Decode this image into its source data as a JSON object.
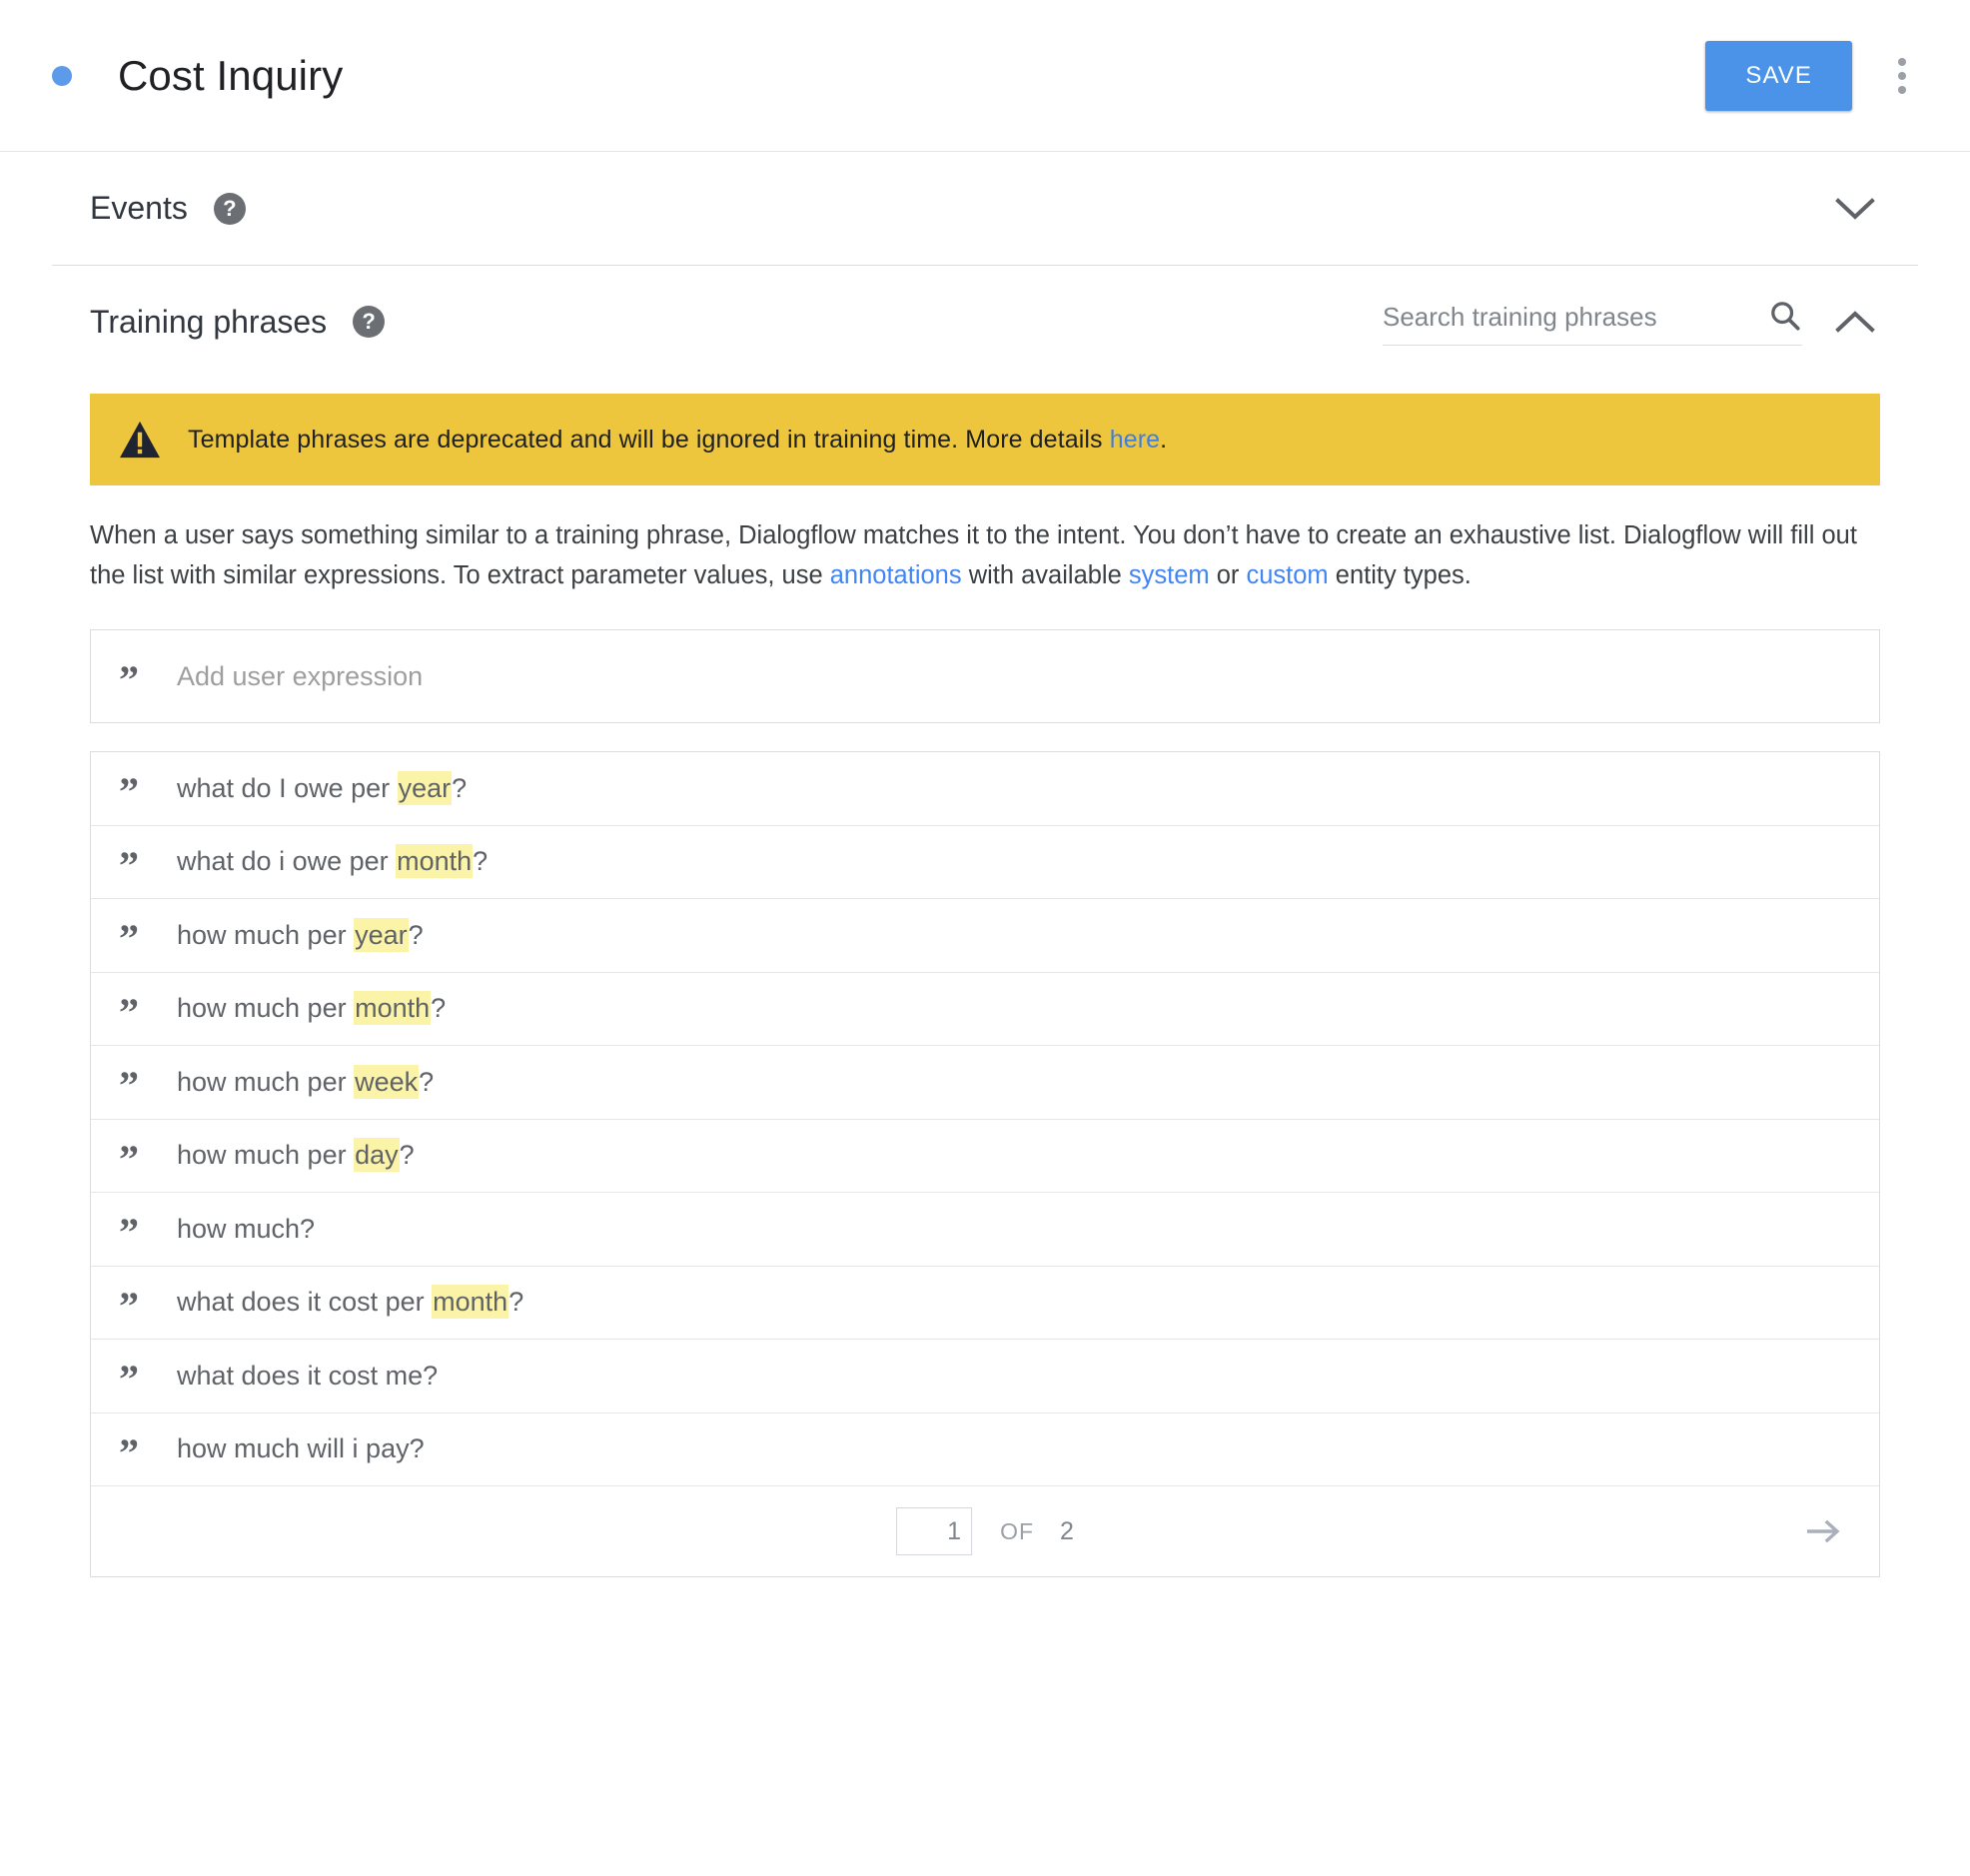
{
  "topbar": {
    "status_dot": "status-dot",
    "title": "Cost Inquiry",
    "save_label": "SAVE",
    "overflow_icon": "more-vert-icon"
  },
  "events": {
    "title": "Events",
    "help_glyph": "?",
    "expand_icon": "chevron-down-icon"
  },
  "training": {
    "title": "Training phrases",
    "help_glyph": "?",
    "search_placeholder": "Search training phrases",
    "search_value": "",
    "search_icon": "search-icon",
    "collapse_icon": "chevron-up-icon",
    "warning": {
      "icon": "warning-triangle-icon",
      "text_before": "Template phrases are deprecated and will be ignored in training time. More details ",
      "link_label": "here",
      "text_after": ".",
      "background": "#edc63e",
      "link_color": "#3f7fe0"
    },
    "description": {
      "part1": "When a user says something similar to a training phrase, Dialogflow matches it to the intent. You don’t have to create an exhaustive list. Dialogflow will fill out the list with similar expressions. To extract parameter values, use ",
      "link1": "annotations",
      "part2": " with available ",
      "link2": "system",
      "part3": " or ",
      "link3": "custom",
      "part4": " entity types.",
      "link_color": "#4285f4"
    },
    "add_expression_placeholder": "Add user expression",
    "add_expression_value": "",
    "quote_glyph": "”",
    "highlight_color": "#fbf4a8",
    "phrases": [
      {
        "before": "what do I owe per ",
        "highlight": "year",
        "after": "?"
      },
      {
        "before": "what do i owe per ",
        "highlight": "month",
        "after": "?"
      },
      {
        "before": "how much per ",
        "highlight": "year",
        "after": "?"
      },
      {
        "before": "how much per ",
        "highlight": "month",
        "after": "?"
      },
      {
        "before": "how much per ",
        "highlight": "week",
        "after": "?"
      },
      {
        "before": "how much per ",
        "highlight": "day",
        "after": "?"
      },
      {
        "before": "how much?",
        "highlight": "",
        "after": ""
      },
      {
        "before": "what does it cost per ",
        "highlight": "month",
        "after": "?"
      },
      {
        "before": "what does it cost me?",
        "highlight": "",
        "after": ""
      },
      {
        "before": "how much will i pay?",
        "highlight": "",
        "after": ""
      }
    ],
    "pagination": {
      "current_page": "1",
      "of_label": "OF",
      "total_pages": "2",
      "next_icon": "arrow-right-icon"
    }
  },
  "colors": {
    "accent_blue": "#4a93e8",
    "warning_yellow": "#edc63e",
    "highlight_yellow": "#fbf4a8",
    "link_blue": "#4285f4"
  }
}
